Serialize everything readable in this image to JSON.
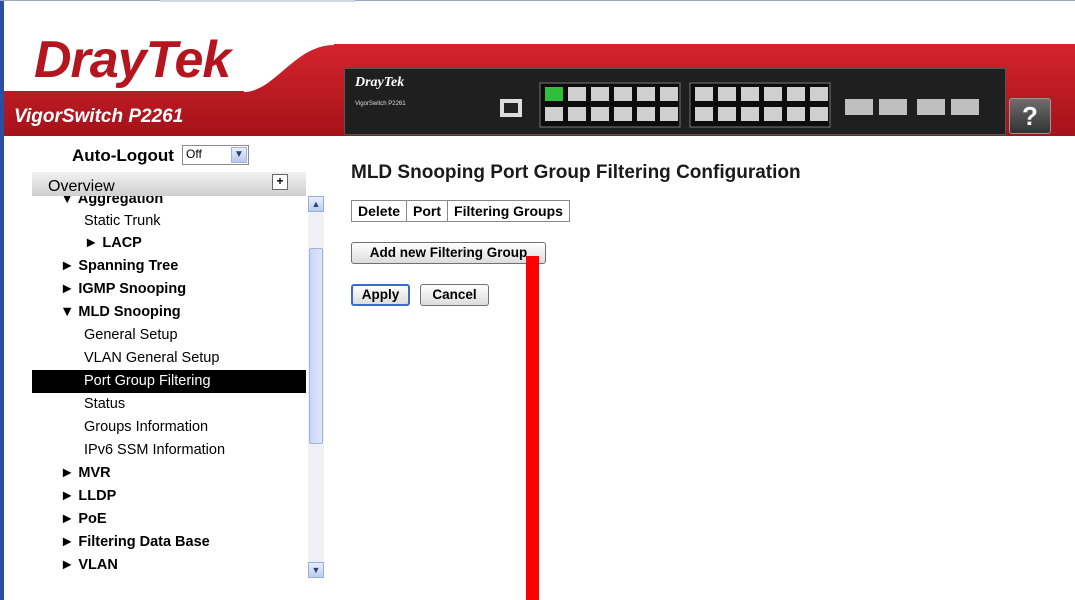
{
  "header": {
    "brand": "DrayTek",
    "model": "VigorSwitch P2261",
    "device_brand": "DrayTek",
    "device_model": "VigorSwitch P2261",
    "help_label": "?"
  },
  "sidebar": {
    "autologout_label": "Auto-Logout",
    "autologout_value": "Off",
    "overview_label": "Overview",
    "items": [
      {
        "label": "▼ Aggregation",
        "bold": true,
        "indent": 1
      },
      {
        "label": "Static Trunk",
        "bold": false,
        "indent": 2
      },
      {
        "label": "► LACP",
        "bold": true,
        "indent": 2
      },
      {
        "label": "► Spanning Tree",
        "bold": true,
        "indent": 1
      },
      {
        "label": "► IGMP Snooping",
        "bold": true,
        "indent": 1
      },
      {
        "label": "▼ MLD Snooping",
        "bold": true,
        "indent": 1
      },
      {
        "label": "General Setup",
        "bold": false,
        "indent": 2
      },
      {
        "label": "VLAN General Setup",
        "bold": false,
        "indent": 2
      },
      {
        "label": "Port Group Filtering",
        "bold": false,
        "indent": 2,
        "selected": true
      },
      {
        "label": "Status",
        "bold": false,
        "indent": 2
      },
      {
        "label": "Groups Information",
        "bold": false,
        "indent": 2
      },
      {
        "label": "IPv6 SSM Information",
        "bold": false,
        "indent": 2
      },
      {
        "label": "► MVR",
        "bold": true,
        "indent": 1
      },
      {
        "label": "► LLDP",
        "bold": true,
        "indent": 1
      },
      {
        "label": "► PoE",
        "bold": true,
        "indent": 1
      },
      {
        "label": "► Filtering Data Base",
        "bold": true,
        "indent": 1
      },
      {
        "label": "► VLAN",
        "bold": true,
        "indent": 1
      }
    ]
  },
  "main": {
    "title": "MLD Snooping Port Group Filtering Configuration",
    "columns": [
      "Delete",
      "Port",
      "Filtering Groups"
    ],
    "add_button": "Add new Filtering Group",
    "apply_button": "Apply",
    "cancel_button": "Cancel"
  },
  "colors": {
    "brand_red": "#b4151f",
    "selected_bg": "#000000",
    "annotation_arrow": "#ff0000"
  }
}
